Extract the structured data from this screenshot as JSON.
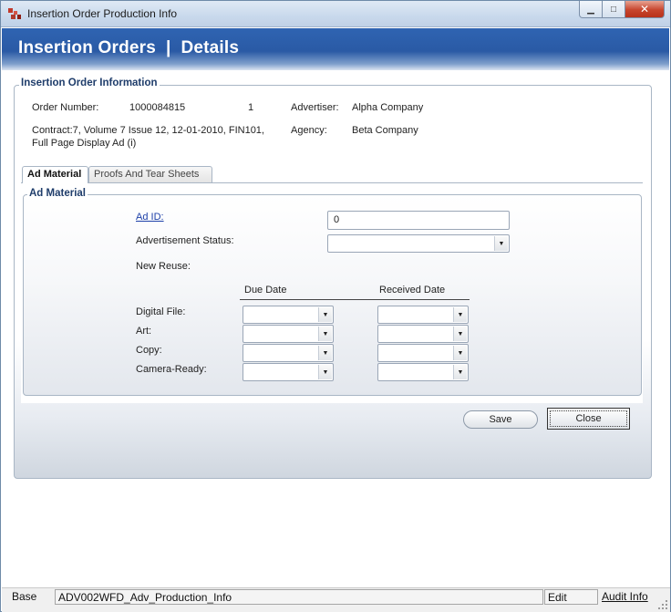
{
  "window": {
    "title": "Insertion Order Production Info",
    "close_glyph": "✕",
    "min_glyph": "▁",
    "max_glyph": "□"
  },
  "banner": {
    "title": "Insertion Orders  |  Details"
  },
  "order_info": {
    "legend": "Insertion Order Information",
    "order_number_label": "Order Number:",
    "order_number_value": "1000084815",
    "order_sequence": "1",
    "advertiser_label": "Advertiser:",
    "advertiser_value": "Alpha Company",
    "contract_line1": "Contract:7, Volume 7 Issue 12, 12-01-2010, FIN101,",
    "contract_line2": "Full Page Display Ad (i)",
    "agency_label": "Agency:",
    "agency_value": "Beta Company"
  },
  "tabs": [
    {
      "label": "Ad Material",
      "active": true
    },
    {
      "label": "Proofs And Tear Sheets",
      "active": false
    }
  ],
  "ad_material": {
    "legend": "Ad Material",
    "ad_id_label": "Ad ID:",
    "ad_id_value": "0",
    "status_label": "Advertisement Status:",
    "status_value": "",
    "new_reuse_label": "New Reuse:",
    "due_date_header": "Due Date",
    "received_date_header": "Received Date",
    "rows": [
      {
        "label": "Digital File:"
      },
      {
        "label": "Art:"
      },
      {
        "label": "Copy:"
      },
      {
        "label": "Camera-Ready:"
      }
    ]
  },
  "buttons": {
    "save": "Save",
    "close": "Close"
  },
  "statusbar": {
    "mode": "Base",
    "form_id": "ADV002WFD_Adv_Production_Info",
    "state": "Edit",
    "audit_link": "Audit Info"
  },
  "icons": {
    "app": "app-logo-icon",
    "dropdown": "chevron-down-icon",
    "grip": "resize-grip-icon"
  },
  "colors": {
    "banner": "#2a5aa5",
    "legend_text": "#1f3d6b",
    "link": "#1c3fa8",
    "close_button": "#c7452d"
  }
}
